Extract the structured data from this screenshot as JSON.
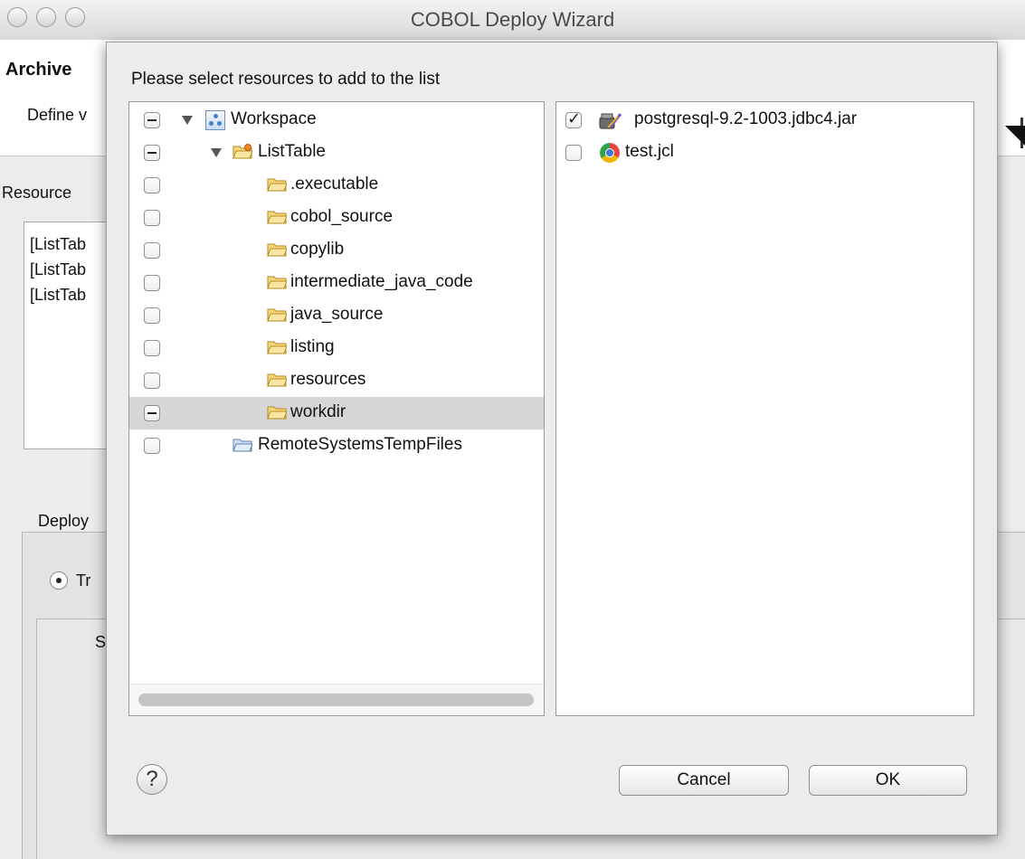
{
  "window": {
    "title": "COBOL Deploy Wizard"
  },
  "background": {
    "heading": "Archive",
    "description": "Define v",
    "resources_label": "Resource",
    "resources": [
      "[ListTab",
      "[ListTab",
      "[ListTab"
    ],
    "deploy_label": "Deploy",
    "radio_label": "Tr",
    "inner_label": "S"
  },
  "dialog": {
    "prompt": "Please select resources to add to the list",
    "tree": [
      {
        "label": "Workspace",
        "check": "mixed",
        "icon": "workspace-icon"
      },
      {
        "label": "ListTable",
        "check": "mixed",
        "icon": "project-folder-icon"
      },
      {
        "label": ".executable",
        "check": "unchecked",
        "icon": "folder-icon"
      },
      {
        "label": "cobol_source",
        "check": "unchecked",
        "icon": "folder-icon"
      },
      {
        "label": "copylib",
        "check": "unchecked",
        "icon": "folder-icon"
      },
      {
        "label": "intermediate_java_code",
        "check": "unchecked",
        "icon": "folder-icon"
      },
      {
        "label": "java_source",
        "check": "unchecked",
        "icon": "folder-icon"
      },
      {
        "label": "listing",
        "check": "unchecked",
        "icon": "folder-icon"
      },
      {
        "label": "resources",
        "check": "unchecked",
        "icon": "folder-icon"
      },
      {
        "label": "workdir",
        "check": "mixed",
        "icon": "folder-icon",
        "selected": true
      },
      {
        "label": "RemoteSystemsTempFiles",
        "check": "unchecked",
        "icon": "folder-icon"
      }
    ],
    "files": [
      {
        "label": "postgresql-9.2-1003.jdbc4.jar",
        "check": "checked",
        "icon": "jar-icon"
      },
      {
        "label": "test.jcl",
        "check": "unchecked",
        "icon": "jcl-icon"
      }
    ],
    "help_label": "?",
    "cancel_label": "Cancel",
    "ok_label": "OK"
  },
  "colors": {
    "selection": "#d6d6d6",
    "folder": "#f2c14e",
    "workspace": "#4a7fc1"
  }
}
